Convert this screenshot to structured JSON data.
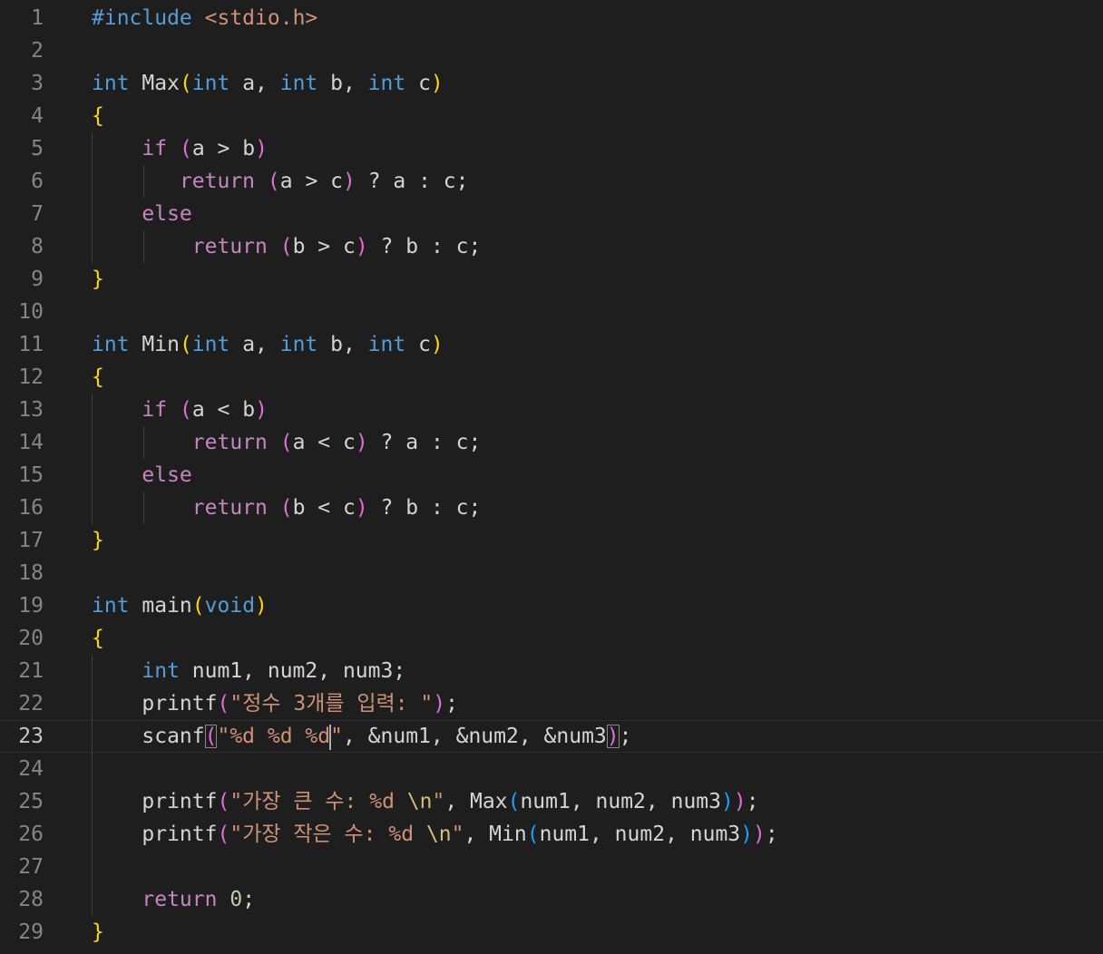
{
  "editor": {
    "current_line": 23,
    "lines": [
      {
        "n": "1",
        "indent": 0,
        "tokens": [
          {
            "t": "pp",
            "v": "#include"
          },
          {
            "t": "p",
            "v": " "
          },
          {
            "t": "inc",
            "v": "<stdio.h>"
          }
        ]
      },
      {
        "n": "2",
        "indent": 0,
        "tokens": []
      },
      {
        "n": "3",
        "indent": 0,
        "tokens": [
          {
            "t": "kw",
            "v": "int"
          },
          {
            "t": "p",
            "v": " Max"
          },
          {
            "t": "b1",
            "v": "("
          },
          {
            "t": "kw",
            "v": "int"
          },
          {
            "t": "p",
            "v": " a, "
          },
          {
            "t": "kw",
            "v": "int"
          },
          {
            "t": "p",
            "v": " b, "
          },
          {
            "t": "kw",
            "v": "int"
          },
          {
            "t": "p",
            "v": " c"
          },
          {
            "t": "b1",
            "v": ")"
          }
        ]
      },
      {
        "n": "4",
        "indent": 0,
        "tokens": [
          {
            "t": "b1",
            "v": "{"
          }
        ]
      },
      {
        "n": "5",
        "indent": 1,
        "tokens": [
          {
            "t": "p",
            "v": "    "
          },
          {
            "t": "ctl",
            "v": "if"
          },
          {
            "t": "p",
            "v": " "
          },
          {
            "t": "b2",
            "v": "("
          },
          {
            "t": "p",
            "v": "a > b"
          },
          {
            "t": "b2",
            "v": ")"
          }
        ]
      },
      {
        "n": "6",
        "indent": 2,
        "tokens": [
          {
            "t": "p",
            "v": "       "
          },
          {
            "t": "ctl",
            "v": "return"
          },
          {
            "t": "p",
            "v": " "
          },
          {
            "t": "b2",
            "v": "("
          },
          {
            "t": "p",
            "v": "a > c"
          },
          {
            "t": "b2",
            "v": ")"
          },
          {
            "t": "p",
            "v": " ? a : c;"
          }
        ]
      },
      {
        "n": "7",
        "indent": 1,
        "tokens": [
          {
            "t": "p",
            "v": "    "
          },
          {
            "t": "ctl",
            "v": "else"
          }
        ]
      },
      {
        "n": "8",
        "indent": 2,
        "tokens": [
          {
            "t": "p",
            "v": "        "
          },
          {
            "t": "ctl",
            "v": "return"
          },
          {
            "t": "p",
            "v": " "
          },
          {
            "t": "b2",
            "v": "("
          },
          {
            "t": "p",
            "v": "b > c"
          },
          {
            "t": "b2",
            "v": ")"
          },
          {
            "t": "p",
            "v": " ? b : c;"
          }
        ]
      },
      {
        "n": "9",
        "indent": 0,
        "tokens": [
          {
            "t": "b1",
            "v": "}"
          }
        ]
      },
      {
        "n": "10",
        "indent": 0,
        "tokens": []
      },
      {
        "n": "11",
        "indent": 0,
        "tokens": [
          {
            "t": "kw",
            "v": "int"
          },
          {
            "t": "p",
            "v": " Min"
          },
          {
            "t": "b1",
            "v": "("
          },
          {
            "t": "kw",
            "v": "int"
          },
          {
            "t": "p",
            "v": " a, "
          },
          {
            "t": "kw",
            "v": "int"
          },
          {
            "t": "p",
            "v": " b, "
          },
          {
            "t": "kw",
            "v": "int"
          },
          {
            "t": "p",
            "v": " c"
          },
          {
            "t": "b1",
            "v": ")"
          }
        ]
      },
      {
        "n": "12",
        "indent": 0,
        "tokens": [
          {
            "t": "b1",
            "v": "{"
          }
        ]
      },
      {
        "n": "13",
        "indent": 1,
        "tokens": [
          {
            "t": "p",
            "v": "    "
          },
          {
            "t": "ctl",
            "v": "if"
          },
          {
            "t": "p",
            "v": " "
          },
          {
            "t": "b2",
            "v": "("
          },
          {
            "t": "p",
            "v": "a < b"
          },
          {
            "t": "b2",
            "v": ")"
          }
        ]
      },
      {
        "n": "14",
        "indent": 2,
        "tokens": [
          {
            "t": "p",
            "v": "        "
          },
          {
            "t": "ctl",
            "v": "return"
          },
          {
            "t": "p",
            "v": " "
          },
          {
            "t": "b2",
            "v": "("
          },
          {
            "t": "p",
            "v": "a < c"
          },
          {
            "t": "b2",
            "v": ")"
          },
          {
            "t": "p",
            "v": " ? a : c;"
          }
        ]
      },
      {
        "n": "15",
        "indent": 1,
        "tokens": [
          {
            "t": "p",
            "v": "    "
          },
          {
            "t": "ctl",
            "v": "else"
          }
        ]
      },
      {
        "n": "16",
        "indent": 2,
        "tokens": [
          {
            "t": "p",
            "v": "        "
          },
          {
            "t": "ctl",
            "v": "return"
          },
          {
            "t": "p",
            "v": " "
          },
          {
            "t": "b2",
            "v": "("
          },
          {
            "t": "p",
            "v": "b < c"
          },
          {
            "t": "b2",
            "v": ")"
          },
          {
            "t": "p",
            "v": " ? b : c;"
          }
        ]
      },
      {
        "n": "17",
        "indent": 0,
        "tokens": [
          {
            "t": "b1",
            "v": "}"
          }
        ]
      },
      {
        "n": "18",
        "indent": 0,
        "tokens": []
      },
      {
        "n": "19",
        "indent": 0,
        "tokens": [
          {
            "t": "kw",
            "v": "int"
          },
          {
            "t": "p",
            "v": " main"
          },
          {
            "t": "b1",
            "v": "("
          },
          {
            "t": "kw",
            "v": "void"
          },
          {
            "t": "b1",
            "v": ")"
          }
        ]
      },
      {
        "n": "20",
        "indent": 0,
        "tokens": [
          {
            "t": "b1",
            "v": "{"
          }
        ]
      },
      {
        "n": "21",
        "indent": 1,
        "tokens": [
          {
            "t": "p",
            "v": "    "
          },
          {
            "t": "kw",
            "v": "int"
          },
          {
            "t": "p",
            "v": " num1, num2, num3;"
          }
        ]
      },
      {
        "n": "22",
        "indent": 1,
        "tokens": [
          {
            "t": "p",
            "v": "    printf"
          },
          {
            "t": "b2",
            "v": "("
          },
          {
            "t": "str",
            "v": "\"정수 3개를 입력: \""
          },
          {
            "t": "b2",
            "v": ")"
          },
          {
            "t": "p",
            "v": ";"
          }
        ]
      },
      {
        "n": "23",
        "indent": 1,
        "tokens": [
          {
            "t": "p",
            "v": "    scanf"
          },
          {
            "t": "b2m",
            "v": "("
          },
          {
            "t": "str",
            "v": "\"%d %d %d"
          },
          {
            "t": "caret",
            "v": ""
          },
          {
            "t": "str",
            "v": "\""
          },
          {
            "t": "p",
            "v": ", &num1, &num2, &num3"
          },
          {
            "t": "b2m",
            "v": ")"
          },
          {
            "t": "p",
            "v": ";"
          }
        ]
      },
      {
        "n": "24",
        "indent": 1,
        "tokens": []
      },
      {
        "n": "25",
        "indent": 1,
        "tokens": [
          {
            "t": "p",
            "v": "    printf"
          },
          {
            "t": "b2",
            "v": "("
          },
          {
            "t": "str",
            "v": "\"가장 큰 수: %d "
          },
          {
            "t": "esc",
            "v": "\\n"
          },
          {
            "t": "str",
            "v": "\""
          },
          {
            "t": "p",
            "v": ", Max"
          },
          {
            "t": "b3",
            "v": "("
          },
          {
            "t": "p",
            "v": "num1, num2, num3"
          },
          {
            "t": "b3",
            "v": ")"
          },
          {
            "t": "b2",
            "v": ")"
          },
          {
            "t": "p",
            "v": ";"
          }
        ]
      },
      {
        "n": "26",
        "indent": 1,
        "tokens": [
          {
            "t": "p",
            "v": "    printf"
          },
          {
            "t": "b2",
            "v": "("
          },
          {
            "t": "str",
            "v": "\"가장 작은 수: %d "
          },
          {
            "t": "esc",
            "v": "\\n"
          },
          {
            "t": "str",
            "v": "\""
          },
          {
            "t": "p",
            "v": ", Min"
          },
          {
            "t": "b3",
            "v": "("
          },
          {
            "t": "p",
            "v": "num1, num2, num3"
          },
          {
            "t": "b3",
            "v": ")"
          },
          {
            "t": "b2",
            "v": ")"
          },
          {
            "t": "p",
            "v": ";"
          }
        ]
      },
      {
        "n": "27",
        "indent": 1,
        "tokens": []
      },
      {
        "n": "28",
        "indent": 1,
        "tokens": [
          {
            "t": "p",
            "v": "    "
          },
          {
            "t": "ctl",
            "v": "return"
          },
          {
            "t": "p",
            "v": " "
          },
          {
            "t": "num",
            "v": "0"
          },
          {
            "t": "p",
            "v": ";"
          }
        ]
      },
      {
        "n": "29",
        "indent": 0,
        "tokens": [
          {
            "t": "b1",
            "v": "}"
          }
        ]
      }
    ]
  }
}
